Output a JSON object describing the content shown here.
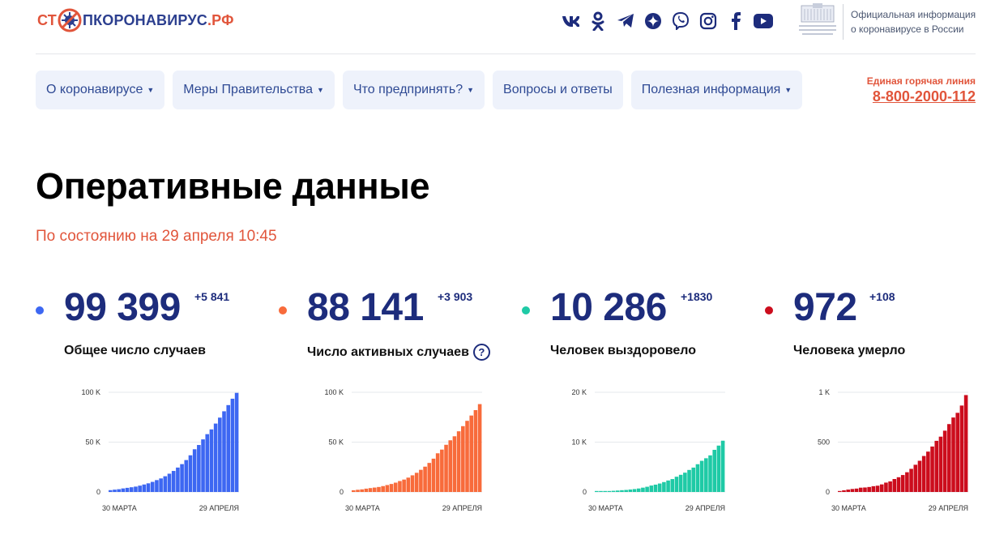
{
  "header": {
    "logo": {
      "part1": "СТ",
      "part2": "ПКОРОНАВИРУС",
      "part3": ".РФ"
    },
    "socials": [
      "vk-icon",
      "odnoklassniki-icon",
      "telegram-icon",
      "yandex-zen-icon",
      "viber-icon",
      "instagram-icon",
      "facebook-icon",
      "youtube-icon"
    ],
    "gov_text_line1": "Официальная информация",
    "gov_text_line2": "о коронавирусе в России"
  },
  "nav": {
    "items": [
      {
        "label": "О коронавирусе",
        "dropdown": true
      },
      {
        "label": "Меры Правительства",
        "dropdown": true
      },
      {
        "label": "Что предпринять?",
        "dropdown": true
      },
      {
        "label": "Вопросы и ответы",
        "dropdown": false
      },
      {
        "label": "Полезная информация",
        "dropdown": true
      }
    ],
    "caret": "▼"
  },
  "hotline": {
    "label": "Единая горячая линия",
    "phone": "8-800-2000-112"
  },
  "main": {
    "title": "Оперативные данные",
    "subtitle": "По состоянию на 29 апреля 10:45"
  },
  "colors": {
    "brand_red": "#e1553b",
    "brand_blue": "#1d2c7c",
    "total": "#3d67f2",
    "active": "#f86b3b",
    "recovered": "#1fcaa6",
    "deaths": "#cc0d1d"
  },
  "stats": [
    {
      "value": "99 399",
      "delta": "+5 841",
      "label": "Общее число случаев",
      "color": "#3d67f2"
    },
    {
      "value": "88 141",
      "delta": "+3 903",
      "label": "Число активных случаев",
      "help": "?",
      "color": "#f86b3b"
    },
    {
      "value": "10 286",
      "delta": "+1830",
      "label": "Человек выздоровело",
      "color": "#1fcaa6"
    },
    {
      "value": "972",
      "delta": "+108",
      "label": "Человека умерло",
      "color": "#cc0d1d"
    }
  ],
  "chart_data": [
    {
      "type": "bar",
      "x_start": "30 МАРТА",
      "x_end": "29 АПРЕЛЯ",
      "yticks": [
        "0",
        "50 K",
        "100 K"
      ],
      "ylim": [
        0,
        100000
      ],
      "color": "#3d67f2",
      "values": [
        1836,
        2337,
        2777,
        3548,
        4149,
        4731,
        5389,
        6343,
        7497,
        8672,
        10131,
        11917,
        13584,
        15770,
        18328,
        21102,
        24490,
        27938,
        32008,
        36793,
        42853,
        47121,
        52763,
        57999,
        62773,
        68622,
        74588,
        80949,
        87147,
        93558,
        99399
      ]
    },
    {
      "type": "bar",
      "x_start": "30 МАРТА",
      "x_end": "29 АПРЕЛЯ",
      "yticks": [
        "0",
        "50 K",
        "100 K"
      ],
      "ylim": [
        0,
        100000
      ],
      "color": "#f86b3b",
      "values": [
        1728,
        2206,
        2617,
        3335,
        3897,
        4418,
        5005,
        5889,
        6952,
        8029,
        9357,
        10968,
        12448,
        14395,
        16710,
        19238,
        22230,
        25402,
        29145,
        33423,
        38800,
        42507,
        47329,
        51831,
        55857,
        60870,
        66030,
        71361,
        76683,
        82101,
        88141
      ]
    },
    {
      "type": "bar",
      "x_start": "30 МАРТА",
      "x_end": "29 АПРЕЛЯ",
      "yticks": [
        "0",
        "10 K",
        "20 K"
      ],
      "ylim": [
        0,
        20000
      ],
      "color": "#1fcaa6",
      "values": [
        66,
        121,
        150,
        190,
        235,
        288,
        355,
        406,
        494,
        580,
        698,
        866,
        1045,
        1291,
        1470,
        1694,
        1986,
        2304,
        2590,
        3057,
        3446,
        3873,
        4420,
        4891,
        5568,
        6250,
        6767,
        7346,
        8456,
        9305,
        10286
      ]
    },
    {
      "type": "bar",
      "x_start": "30 МАРТА",
      "x_end": "29 АПРЕЛЯ",
      "yticks": [
        "0",
        "500",
        "1 K"
      ],
      "ylim": [
        0,
        1000
      ],
      "color": "#cc0d1d",
      "values": [
        9,
        17,
        24,
        30,
        34,
        43,
        45,
        50,
        58,
        63,
        76,
        94,
        106,
        130,
        148,
        170,
        198,
        232,
        273,
        313,
        361,
        405,
        456,
        513,
        555,
        615,
        681,
        747,
        794,
        867,
        972
      ]
    }
  ]
}
